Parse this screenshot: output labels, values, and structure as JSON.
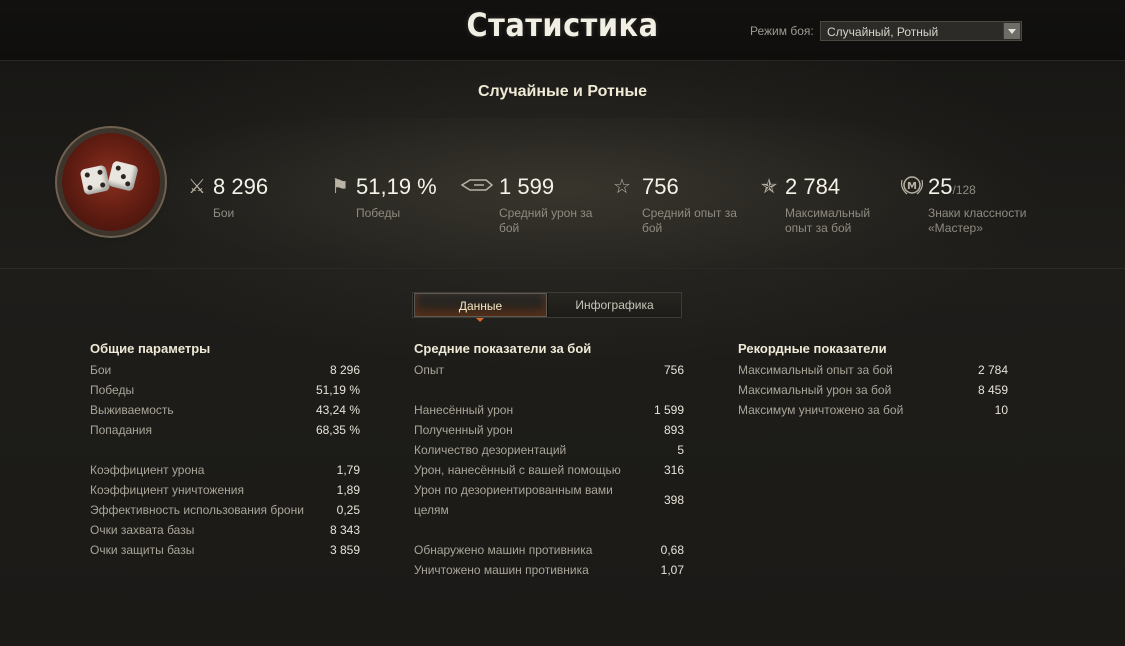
{
  "header": {
    "title": "Статистика",
    "mode_label": "Режим боя:",
    "mode_value": "Случайный, Ротный"
  },
  "subtitle": "Случайные и Ротные",
  "summary": [
    {
      "icon": "crossed-swords-icon",
      "value": "8 296",
      "label": "Бои"
    },
    {
      "icon": "flag-icon",
      "value": "51,19 %",
      "label": "Победы"
    },
    {
      "icon": "shell-icon",
      "value": "1 599",
      "label": "Средний урон за бой"
    },
    {
      "icon": "star-wings-icon",
      "value": "756",
      "label": "Средний опыт за бой"
    },
    {
      "icon": "star-rays-icon",
      "value": "2 784",
      "label": "Максимальный опыт за бой"
    },
    {
      "icon": "mastery-badge-icon",
      "value": "25",
      "value_small": "/128",
      "label": "Знаки классности «Мастер»"
    }
  ],
  "tabs": [
    "Данные",
    "Инфографика"
  ],
  "general": {
    "heading": "Общие параметры",
    "group1": [
      {
        "k": "Бои",
        "v": "8 296"
      },
      {
        "k": "Победы",
        "v": "51,19 %"
      },
      {
        "k": "Выживаемость",
        "v": "43,24 %"
      },
      {
        "k": "Попадания",
        "v": "68,35 %"
      }
    ],
    "group2": [
      {
        "k": "Коэффициент урона",
        "v": "1,79"
      },
      {
        "k": "Коэффициент уничтожения",
        "v": "1,89"
      },
      {
        "k": "Эффективность использования брони",
        "v": "0,25"
      },
      {
        "k": "Очки захвата базы",
        "v": "8 343"
      },
      {
        "k": "Очки защиты базы",
        "v": "3 859"
      }
    ]
  },
  "average": {
    "heading": "Средние показатели за бой",
    "group1": [
      {
        "k": "Опыт",
        "v": "756"
      }
    ],
    "group2": [
      {
        "k": "Нанесённый урон",
        "v": "1 599"
      },
      {
        "k": "Полученный урон",
        "v": "893"
      },
      {
        "k": "Количество дезориентаций",
        "v": "5"
      },
      {
        "k": "Урон, нанесённый с вашей помощью",
        "v": "316"
      },
      {
        "k": "Урон по дезориентированным вами целям",
        "v": "398"
      }
    ],
    "group3": [
      {
        "k": "Обнаружено машин противника",
        "v": "0,68"
      },
      {
        "k": "Уничтожено машин противника",
        "v": "1,07"
      }
    ]
  },
  "records": {
    "heading": "Рекордные показатели",
    "group1": [
      {
        "k": "Максимальный опыт за бой",
        "v": "2 784"
      },
      {
        "k": "Максимальный урон за бой",
        "v": "8 459"
      },
      {
        "k": "Максимум уничтожено за бой",
        "v": "10"
      }
    ]
  }
}
